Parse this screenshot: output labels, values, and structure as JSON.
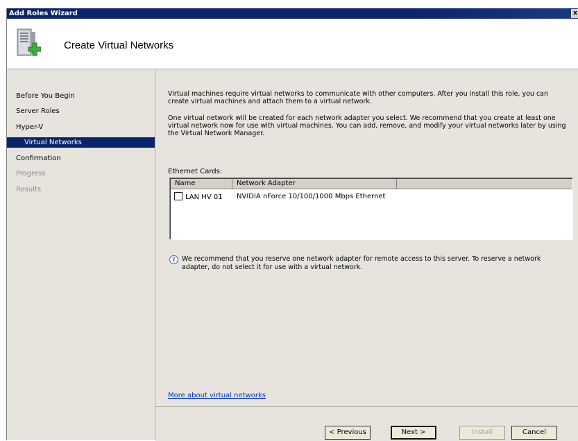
{
  "window": {
    "title": "Add Roles Wizard",
    "close_glyph": "x"
  },
  "header": {
    "page_title": "Create Virtual Networks",
    "icon": "server-add-icon"
  },
  "sidebar": {
    "items": [
      {
        "label": "Before You Begin",
        "state": "normal"
      },
      {
        "label": "Server Roles",
        "state": "normal"
      },
      {
        "label": "Hyper-V",
        "state": "normal"
      },
      {
        "label": "Virtual Networks",
        "state": "selected"
      },
      {
        "label": "Confirmation",
        "state": "normal"
      },
      {
        "label": "Progress",
        "state": "disabled"
      },
      {
        "label": "Results",
        "state": "disabled"
      }
    ]
  },
  "content": {
    "para1": "Virtual machines require virtual networks to communicate with other computers. After you install this role, you can create virtual machines and attach them to a virtual network.",
    "para2": "One virtual network will be created for each network adapter you select. We recommend that you create at least one virtual network now for use with virtual machines. You can add, remove, and modify your virtual networks later by using the Virtual Network Manager.",
    "ethernet_label": "Ethernet Cards:",
    "table": {
      "columns": [
        "Name",
        "Network Adapter"
      ],
      "rows": [
        {
          "checked": false,
          "name": "LAN HV 01",
          "adapter": "NVIDIA nForce 10/100/1000 Mbps Ethernet"
        }
      ]
    },
    "info_text": "We recommend that you reserve one network adapter for remote access to this server. To reserve a network adapter, do not select it for use with a virtual network.",
    "more_link": "More about virtual networks"
  },
  "buttons": {
    "previous": "< Previous",
    "next": "Next >",
    "install": "Install",
    "cancel": "Cancel"
  },
  "colors": {
    "selection": "#0a246a",
    "titlebar": "#0a246a",
    "link": "#0033cc"
  }
}
